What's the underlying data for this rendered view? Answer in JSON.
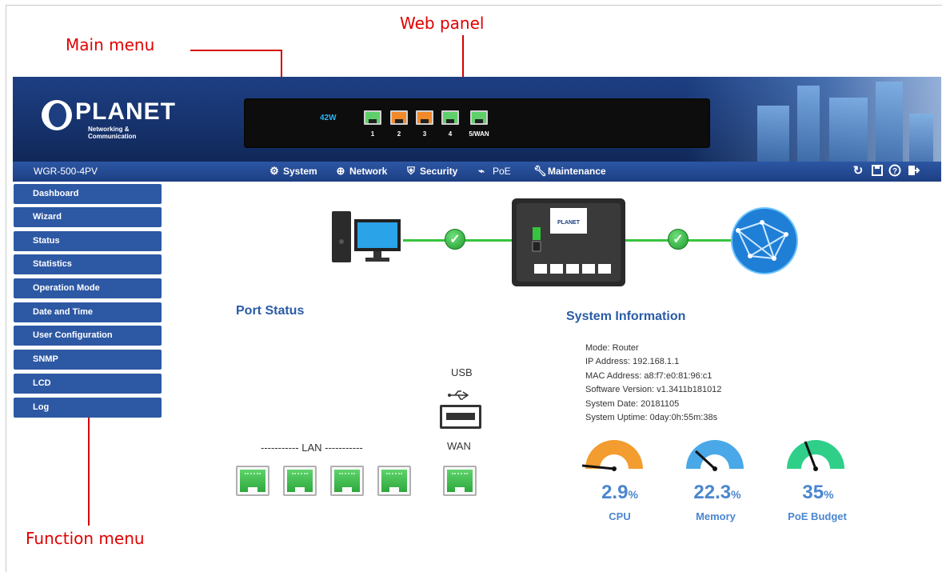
{
  "callouts": {
    "web_panel": "Web panel",
    "main_menu": "Main menu",
    "function_menu": "Function menu"
  },
  "header": {
    "brand": "PLANET",
    "brand_sub": "Networking & Communication",
    "panel": {
      "watt": "42W",
      "ports": [
        "1",
        "2",
        "3",
        "4",
        "5/WAN"
      ]
    }
  },
  "navbar": {
    "model": "WGR-500-4PV",
    "menu": {
      "system": "System",
      "network": "Network",
      "security": "Security",
      "poe": "PoE",
      "maintenance": "Maintenance"
    },
    "tools": [
      "refresh-icon",
      "save-icon",
      "help-icon",
      "logout-icon"
    ]
  },
  "sidebar": {
    "items": [
      {
        "label": "Dashboard"
      },
      {
        "label": "Wizard"
      },
      {
        "label": "Status"
      },
      {
        "label": "Statistics"
      },
      {
        "label": "Operation Mode"
      },
      {
        "label": "Date and Time"
      },
      {
        "label": "User Configuration"
      },
      {
        "label": "SNMP"
      },
      {
        "label": "LCD"
      },
      {
        "label": "Log"
      }
    ]
  },
  "port_status": {
    "title": "Port Status",
    "usb_label": "USB",
    "wan_label": "WAN",
    "lan_label": "----------- LAN -----------"
  },
  "system_info": {
    "title": "System Information",
    "mode": "Mode: Router",
    "ip": "IP Address: 192.168.1.1",
    "mac": "MAC Address: a8:f7:e0:81:96:c1",
    "software": "Software Version: v1.3411b181012",
    "date": "System Date: 20181105",
    "uptime": "System Uptime: 0day:0h:55m:38s"
  },
  "gauges": [
    {
      "label": "CPU",
      "value": "2.9",
      "unit": "%",
      "color": "#f39c2f"
    },
    {
      "label": "Memory",
      "value": "22.3",
      "unit": "%",
      "color": "#4aa8e8"
    },
    {
      "label": "PoE Budget",
      "value": "35",
      "unit": "%",
      "color": "#2fcf8a"
    }
  ],
  "colors": {
    "header_bg": "#1d3f82",
    "sidebar_btn": "#2d58a3",
    "title_blue": "#2a5ca6",
    "callout_red": "#e00000",
    "link_green": "#37c43f"
  }
}
